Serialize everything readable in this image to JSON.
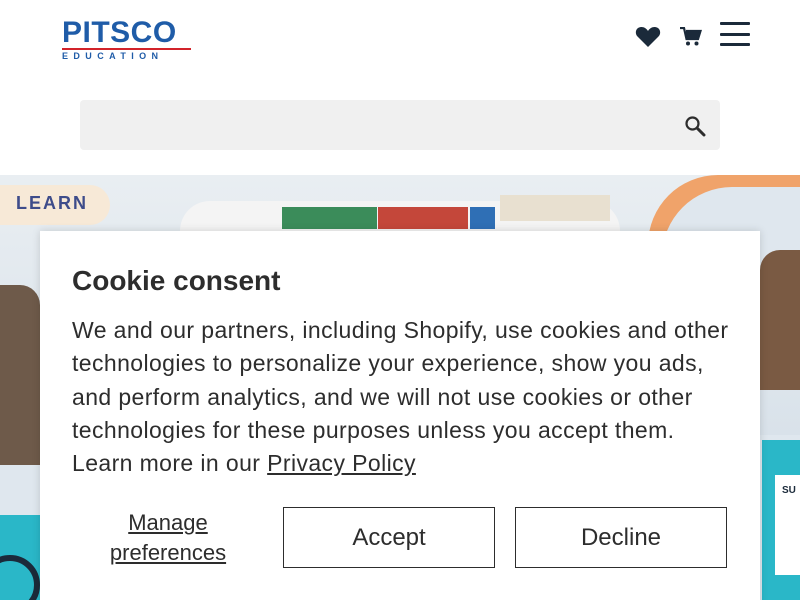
{
  "header": {
    "logo_name": "PITSCO",
    "logo_sub": "EDUCATION",
    "icons": [
      "heart-icon",
      "cart-icon",
      "menu-icon"
    ]
  },
  "search": {
    "placeholder": "",
    "value": "",
    "icon": "search-icon"
  },
  "hero": {
    "banner_text": "LEARN",
    "card_text": "SU"
  },
  "cookie": {
    "title": "Cookie consent",
    "body": "We and our partners, including Shopify, use cookies and other technologies to personalize your experience, show you ads, and perform analytics, and we will not use cookies or other technologies for these purposes unless you accept them. Learn more in our ",
    "privacy_link": "Privacy Policy",
    "manage_label": "Manage preferences",
    "accept_label": "Accept",
    "decline_label": "Decline"
  },
  "colors": {
    "brand": "#1f5ca8",
    "brand_accent": "#d2232a",
    "text": "#2d2d2d",
    "search_bg": "#f0f0f0",
    "teal": "#2ab7c8"
  }
}
